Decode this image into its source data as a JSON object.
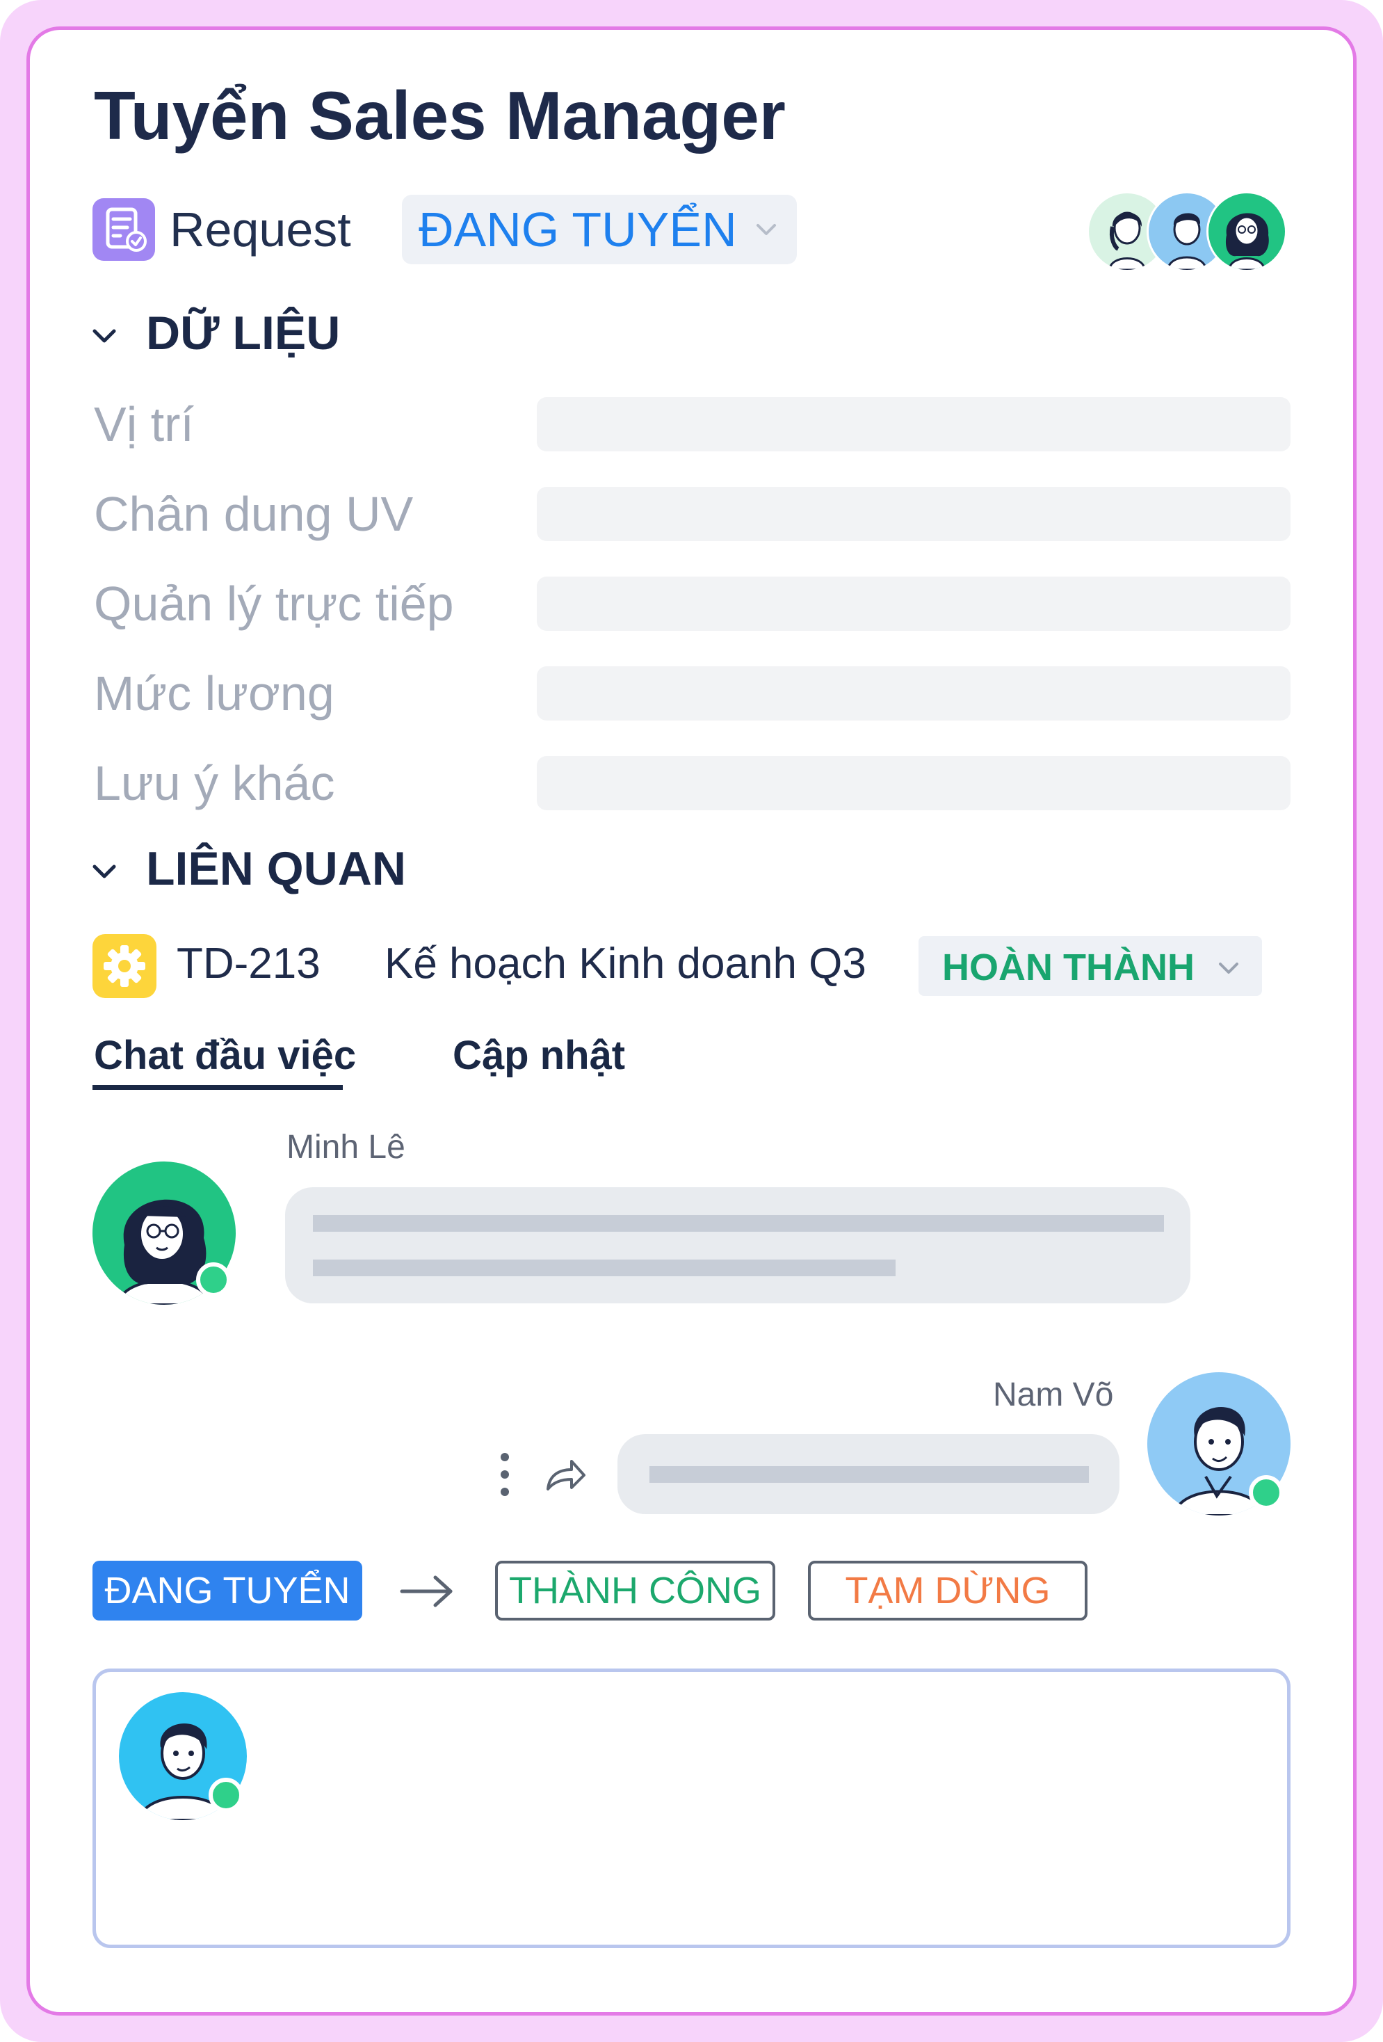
{
  "header": {
    "title": "Tuyển Sales Manager",
    "request_label": "Request",
    "status": "ĐANG TUYỂN"
  },
  "data_section": {
    "title": "DỮ LIỆU",
    "fields": [
      {
        "label": "Vị trí",
        "value": ""
      },
      {
        "label": "Chân dung UV",
        "value": ""
      },
      {
        "label": "Quản lý trực tiếp",
        "value": ""
      },
      {
        "label": "Mức lương",
        "value": ""
      },
      {
        "label": "Lưu ý khác",
        "value": ""
      }
    ]
  },
  "related_section": {
    "title": "LIÊN QUAN",
    "item": {
      "id": "TD-213",
      "name": "Kế hoạch Kinh doanh Q3",
      "status": "HOÀN THÀNH"
    }
  },
  "tabs": [
    {
      "label": "Chat đầu việc",
      "active": true
    },
    {
      "label": "Cập nhật",
      "active": false
    }
  ],
  "messages": [
    {
      "sender": "Minh Lê"
    },
    {
      "sender": "Nam Võ"
    }
  ],
  "status_flow": {
    "current": "ĐANG TUYỂN",
    "options": [
      "THÀNH CÔNG",
      "TẠM DỪNG"
    ]
  },
  "icons": {
    "request": "request-document-icon",
    "related": "gear-icon",
    "more": "more-vertical-icon",
    "forward": "forward-icon",
    "arrow": "arrow-right-icon",
    "chevron": "chevron-down-icon"
  },
  "colors": {
    "frame": "#f7d4fb",
    "border": "#e37ae6",
    "accent_blue": "#2f83ef",
    "success_green": "#19a56f",
    "warning_orange": "#f27a45",
    "online": "#2fd08a"
  }
}
